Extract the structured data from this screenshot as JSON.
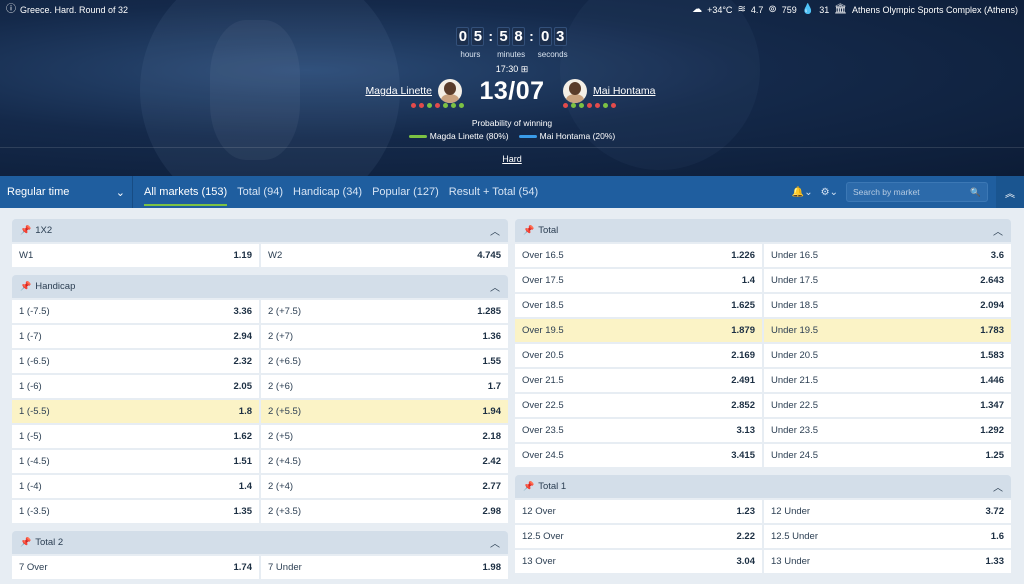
{
  "header": {
    "event": "Greece. Hard. Round of 32",
    "weather": {
      "temp": "+34°C",
      "wind": "4.7",
      "pressure": "759",
      "humidity": "31"
    },
    "venue": "Athens Olympic Sports Complex (Athens)",
    "countdown": {
      "hours": [
        "0",
        "5"
      ],
      "minutes": [
        "5",
        "8"
      ],
      "seconds": [
        "0",
        "3"
      ],
      "hours_label": "hours",
      "minutes_label": "minutes",
      "seconds_label": "seconds"
    },
    "start_time": "17:30",
    "score": "13/07",
    "player1": {
      "name": "Magda Linette",
      "form": [
        "#e34b4b",
        "#e34b4b",
        "#7cc243",
        "#e34b4b",
        "#7cc243",
        "#7cc243",
        "#7cc243"
      ]
    },
    "player2": {
      "name": "Mai Hontama",
      "form": [
        "#e34b4b",
        "#7cc243",
        "#7cc243",
        "#e34b4b",
        "#e34b4b",
        "#7cc243",
        "#e34b4b"
      ]
    },
    "probability_title": "Probability of winning",
    "probability": [
      {
        "label": "Magda Linette (80%)",
        "color": "#7cc243"
      },
      {
        "label": "Mai Hontama (20%)",
        "color": "#3a9be8"
      }
    ],
    "surface": "Hard"
  },
  "nav": {
    "period": "Regular time",
    "tabs": [
      {
        "label": "All markets (153)"
      },
      {
        "label": "Total (94)"
      },
      {
        "label": "Handicap (34)"
      },
      {
        "label": "Popular (127)"
      },
      {
        "label": "Result + Total (54)"
      }
    ],
    "search_placeholder": "Search by market"
  },
  "markets_left": {
    "x12": {
      "title": "1X2",
      "rows": [
        [
          "W1",
          "1.19",
          "W2",
          "4.745"
        ]
      ]
    },
    "handicap": {
      "title": "Handicap",
      "rows": [
        [
          "1 (-7.5)",
          "3.36",
          "2 (+7.5)",
          "1.285"
        ],
        [
          "1 (-7)",
          "2.94",
          "2 (+7)",
          "1.36"
        ],
        [
          "1 (-6.5)",
          "2.32",
          "2 (+6.5)",
          "1.55"
        ],
        [
          "1 (-6)",
          "2.05",
          "2 (+6)",
          "1.7"
        ],
        [
          "1 (-5.5)",
          "1.8",
          "2 (+5.5)",
          "1.94"
        ],
        [
          "1 (-5)",
          "1.62",
          "2 (+5)",
          "2.18"
        ],
        [
          "1 (-4.5)",
          "1.51",
          "2 (+4.5)",
          "2.42"
        ],
        [
          "1 (-4)",
          "1.4",
          "2 (+4)",
          "2.77"
        ],
        [
          "1 (-3.5)",
          "1.35",
          "2 (+3.5)",
          "2.98"
        ]
      ]
    },
    "total2": {
      "title": "Total 2",
      "rows": [
        [
          "7 Over",
          "1.74",
          "7 Under",
          "1.98"
        ]
      ]
    }
  },
  "markets_right": {
    "total": {
      "title": "Total",
      "rows": [
        [
          "Over 16.5",
          "1.226",
          "Under 16.5",
          "3.6"
        ],
        [
          "Over 17.5",
          "1.4",
          "Under 17.5",
          "2.643"
        ],
        [
          "Over 18.5",
          "1.625",
          "Under 18.5",
          "2.094"
        ],
        [
          "Over 19.5",
          "1.879",
          "Under 19.5",
          "1.783"
        ],
        [
          "Over 20.5",
          "2.169",
          "Under 20.5",
          "1.583"
        ],
        [
          "Over 21.5",
          "2.491",
          "Under 21.5",
          "1.446"
        ],
        [
          "Over 22.5",
          "2.852",
          "Under 22.5",
          "1.347"
        ],
        [
          "Over 23.5",
          "3.13",
          "Under 23.5",
          "1.292"
        ],
        [
          "Over 24.5",
          "3.415",
          "Under 24.5",
          "1.25"
        ]
      ]
    },
    "total1": {
      "title": "Total 1",
      "rows": [
        [
          "12 Over",
          "1.23",
          "12 Under",
          "3.72"
        ],
        [
          "12.5 Over",
          "2.22",
          "12.5 Under",
          "1.6"
        ],
        [
          "13 Over",
          "3.04",
          "13 Under",
          "1.33"
        ]
      ]
    }
  },
  "colors": {
    "accent_green": "#7cc243",
    "nav_blue": "#1f5e9f",
    "highlight": "#fbf3c6"
  }
}
